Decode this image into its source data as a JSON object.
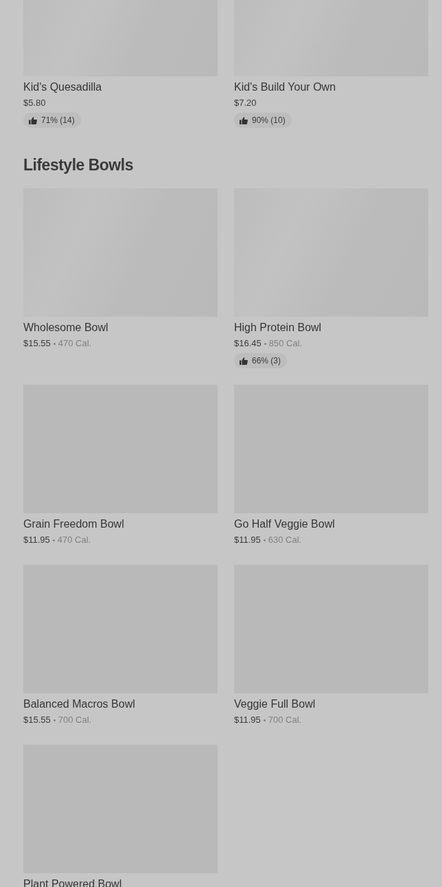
{
  "sections": [
    {
      "items": [
        {
          "name": "Kid's Quesadilla",
          "price": "$5.80",
          "rating": "71% (14)"
        },
        {
          "name": "Kid's Build Your Own",
          "price": "$7.20",
          "rating": "90% (10)"
        }
      ]
    },
    {
      "heading": "Lifestyle Bowls",
      "items": [
        {
          "name": "Wholesome Bowl",
          "price": "$15.55",
          "calories": "470 Cal."
        },
        {
          "name": "High Protein Bowl",
          "price": "$16.45",
          "calories": "850 Cal.",
          "rating": "66% (3)"
        },
        {
          "name": "Grain Freedom Bowl",
          "price": "$11.95",
          "calories": "470 Cal."
        },
        {
          "name": "Go Half Veggie Bowl",
          "price": "$11.95",
          "calories": "630 Cal."
        },
        {
          "name": "Balanced Macros Bowl",
          "price": "$15.55",
          "calories": "700 Cal."
        },
        {
          "name": "Veggie Full Bowl",
          "price": "$11.95",
          "calories": "700 Cal."
        },
        {
          "name": "Plant Powered Bowl"
        }
      ]
    }
  ]
}
